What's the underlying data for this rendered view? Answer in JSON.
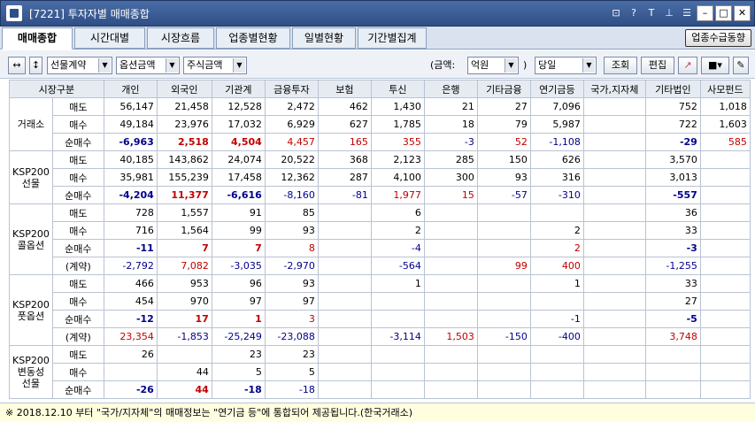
{
  "window": {
    "title": "[7221] 투자자별 매매종합"
  },
  "tabs": [
    "매매종합",
    "시간대별",
    "시장흐름",
    "업종별현황",
    "일별현황",
    "기간별집계"
  ],
  "tab_right": "업종수급동향",
  "toolbar": {
    "combo1": "선물계약",
    "combo2": "옵션금액",
    "combo3": "주식금액",
    "amount_label": "(금액:",
    "unit": "억원",
    "paren_close": ")",
    "period": "당일",
    "query_btn": "조회",
    "edit_btn": "편집"
  },
  "columns": [
    "시장구분",
    "개인",
    "외국인",
    "기관계",
    "금융투자",
    "보험",
    "투신",
    "은행",
    "기타금융",
    "연기금등",
    "국가,지자체",
    "기타법인",
    "사모펀드"
  ],
  "markets": [
    {
      "name": "거래소",
      "rows": [
        {
          "label": "매도",
          "cells": [
            "56,147",
            "21,458",
            "12,528",
            "2,472",
            "462",
            "1,430",
            "21",
            "27",
            "7,096",
            "",
            "752",
            "1,018"
          ]
        },
        {
          "label": "매수",
          "cells": [
            "49,184",
            "23,976",
            "17,032",
            "6,929",
            "627",
            "1,785",
            "18",
            "79",
            "5,987",
            "",
            "722",
            "1,603"
          ]
        },
        {
          "label": "순매수",
          "cells": [
            "-6,963",
            "2,518",
            "4,504",
            "4,457",
            "165",
            "355",
            "-3",
            "52",
            "-1,108",
            "",
            "-29",
            "585"
          ]
        }
      ]
    },
    {
      "name": "KSP200 선물",
      "rows": [
        {
          "label": "매도",
          "cells": [
            "40,185",
            "143,862",
            "24,074",
            "20,522",
            "368",
            "2,123",
            "285",
            "150",
            "626",
            "",
            "3,570",
            ""
          ]
        },
        {
          "label": "매수",
          "cells": [
            "35,981",
            "155,239",
            "17,458",
            "12,362",
            "287",
            "4,100",
            "300",
            "93",
            "316",
            "",
            "3,013",
            ""
          ]
        },
        {
          "label": "순매수",
          "cells": [
            "-4,204",
            "11,377",
            "-6,616",
            "-8,160",
            "-81",
            "1,977",
            "15",
            "-57",
            "-310",
            "",
            "-557",
            ""
          ]
        }
      ]
    },
    {
      "name": "KSP200 콜옵션",
      "rows": [
        {
          "label": "매도",
          "cells": [
            "728",
            "1,557",
            "91",
            "85",
            "",
            "6",
            "",
            "",
            "",
            "",
            "36",
            ""
          ]
        },
        {
          "label": "매수",
          "cells": [
            "716",
            "1,564",
            "99",
            "93",
            "",
            "2",
            "",
            "",
            "2",
            "",
            "33",
            ""
          ]
        },
        {
          "label": "순매수",
          "cells": [
            "-11",
            "7",
            "7",
            "8",
            "",
            "-4",
            "",
            "",
            "2",
            "",
            "-3",
            ""
          ]
        },
        {
          "label": "(계약)",
          "cells": [
            "-2,792",
            "7,082",
            "-3,035",
            "-2,970",
            "",
            "-564",
            "",
            "99",
            "400",
            "",
            "-1,255",
            ""
          ]
        }
      ]
    },
    {
      "name": "KSP200 풋옵션",
      "rows": [
        {
          "label": "매도",
          "cells": [
            "466",
            "953",
            "96",
            "93",
            "",
            "1",
            "",
            "",
            "1",
            "",
            "33",
            ""
          ]
        },
        {
          "label": "매수",
          "cells": [
            "454",
            "970",
            "97",
            "97",
            "",
            "",
            "",
            "",
            "",
            "",
            "27",
            ""
          ]
        },
        {
          "label": "순매수",
          "cells": [
            "-12",
            "17",
            "1",
            "3",
            "",
            "",
            "",
            "",
            "-1",
            "",
            "-5",
            ""
          ]
        },
        {
          "label": "(계약)",
          "cells": [
            "23,354",
            "-1,853",
            "-25,249",
            "-23,088",
            "",
            "-3,114",
            "1,503",
            "-150",
            "-400",
            "",
            "3,748",
            ""
          ]
        }
      ]
    },
    {
      "name": "KSP200 변동성 선물",
      "rows": [
        {
          "label": "매도",
          "cells": [
            "26",
            "",
            "23",
            "23",
            "",
            "",
            "",
            "",
            "",
            "",
            "",
            ""
          ]
        },
        {
          "label": "매수",
          "cells": [
            "",
            "44",
            "5",
            "5",
            "",
            "",
            "",
            "",
            "",
            "",
            "",
            ""
          ]
        },
        {
          "label": "순매수",
          "cells": [
            "-26",
            "44",
            "-18",
            "-18",
            "",
            "",
            "",
            "",
            "",
            "",
            "",
            ""
          ]
        }
      ]
    }
  ],
  "footer": "※ 2018.12.10 부터 \"국가/지자체\"의 매매정보는 \"연기금 등\"에 통합되어 제공됩니다.(한국거래소)"
}
